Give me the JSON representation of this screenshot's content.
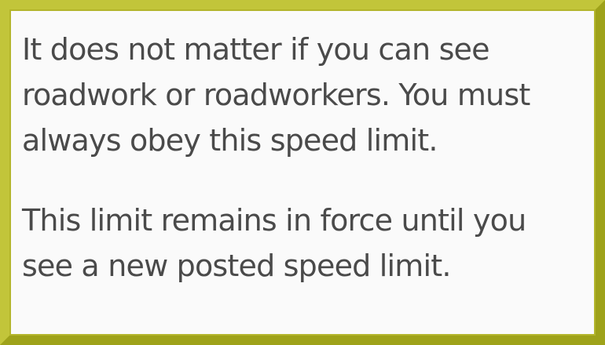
{
  "card": {
    "paragraphs": [
      {
        "lines": [
          "It does not matter if you can see",
          "roadwork or roadworkers. You must",
          "always obey this speed limit."
        ]
      },
      {
        "lines": [
          "This limit remains in force until you",
          "see a new posted speed limit."
        ]
      }
    ],
    "colors": {
      "border": "#b3b52b",
      "background": "#fafafa",
      "text": "#4a4a4a"
    }
  }
}
